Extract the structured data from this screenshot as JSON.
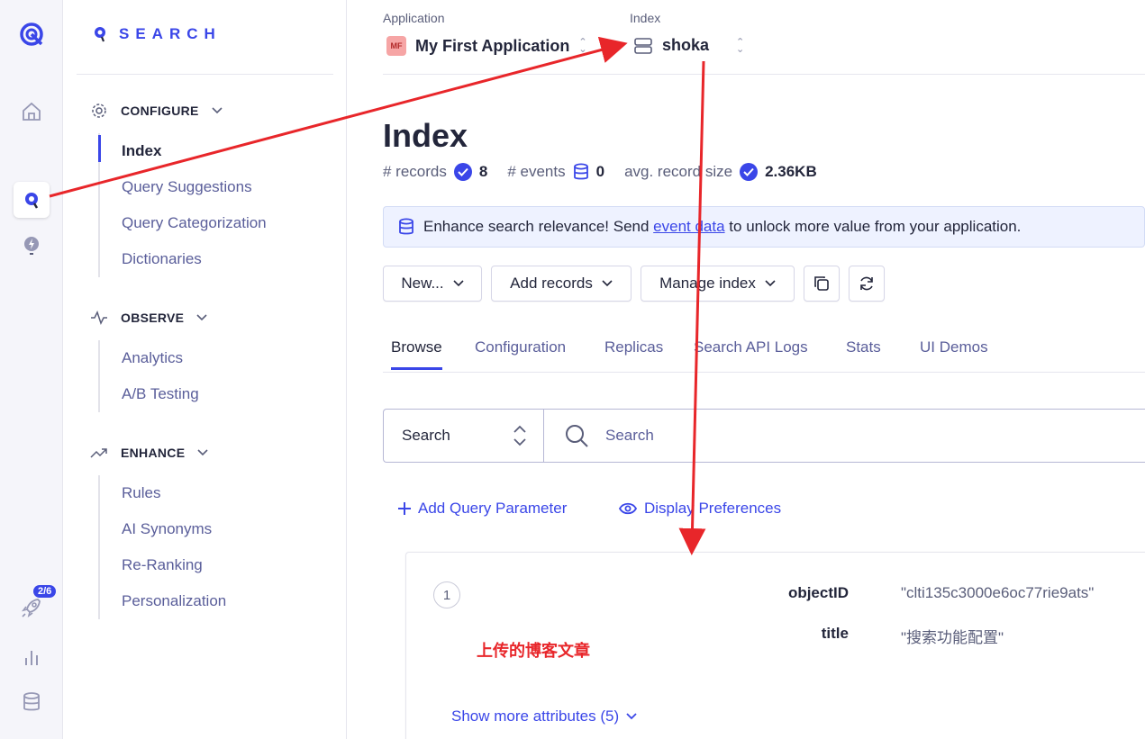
{
  "sidebar": {
    "brand": "SEARCH",
    "onboarding_badge": "2/6",
    "sections": [
      {
        "label": "CONFIGURE",
        "items": [
          "Index",
          "Query Suggestions",
          "Query Categorization",
          "Dictionaries"
        ]
      },
      {
        "label": "OBSERVE",
        "items": [
          "Analytics",
          "A/B Testing"
        ]
      },
      {
        "label": "ENHANCE",
        "items": [
          "Rules",
          "AI Synonyms",
          "Re-Ranking",
          "Personalization"
        ]
      }
    ]
  },
  "header": {
    "application_label": "Application",
    "application_avatar": "MF",
    "application_name": "My First Application",
    "index_label": "Index",
    "index_name": "shoka"
  },
  "page": {
    "title": "Index",
    "stats": {
      "records_label": "# records",
      "records_value": "8",
      "events_label": "# events",
      "events_value": "0",
      "size_label": "avg. record size",
      "size_value": "2.36KB"
    },
    "banner": {
      "prefix": "Enhance search relevance! Send ",
      "link": "event data",
      "suffix": " to unlock more value from your application."
    },
    "toolbar": {
      "new_label": "New...",
      "add_records_label": "Add records",
      "manage_index_label": "Manage index"
    },
    "tabs": [
      "Browse",
      "Configuration",
      "Replicas",
      "Search API Logs",
      "Stats",
      "UI Demos"
    ],
    "search": {
      "mode": "Search",
      "placeholder": "Search"
    },
    "links": {
      "add_param": "Add Query Parameter",
      "display_prefs": "Display Preferences"
    },
    "record": {
      "index": "1",
      "attrs": [
        {
          "key": "objectID",
          "value": "\"clti135c3000e6oc77rie9ats\""
        },
        {
          "key": "title",
          "value": "\"搜索功能配置\""
        }
      ],
      "show_more": "Show more attributes (5)"
    },
    "annotation": "上传的博客文章"
  },
  "colors": {
    "accent": "#3a46e8",
    "annotation": "#e8262a"
  }
}
